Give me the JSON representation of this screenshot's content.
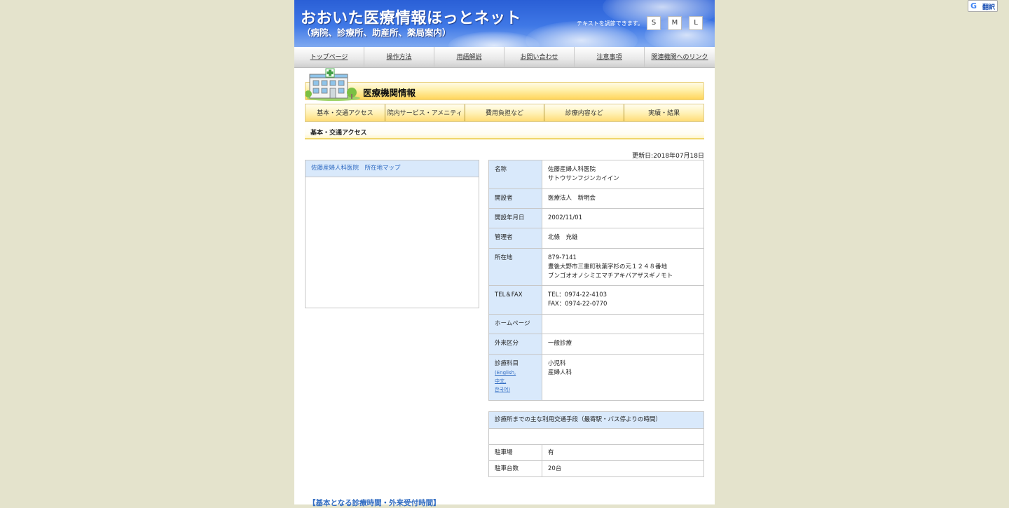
{
  "translate": {
    "g_icon": "G",
    "label": "翻訳"
  },
  "header": {
    "title": "おおいた医療情報ほっとネット",
    "subtitle": "（病院、診療所、助産所、薬局案内）",
    "textsize_label": "テキストを調節できます。",
    "sizes": [
      "S",
      "M",
      "L"
    ]
  },
  "nav": {
    "items": [
      "トップページ",
      "操作方法",
      "用語解説",
      "お問い合わせ",
      "注意事項",
      "関連機関へのリンク"
    ]
  },
  "section": {
    "title": "医療機関情報",
    "icon": "hospital-icon"
  },
  "tabs": [
    "基本・交通アクセス",
    "院内サービス・アメニティ",
    "費用負担など",
    "診療内容など",
    "実績・結果"
  ],
  "subhead": "基本・交通アクセス",
  "updated": "更新日:2018年07月18日",
  "map": {
    "title": "佐藤産婦人科医院　所在地マップ"
  },
  "info": {
    "name_label": "名称",
    "name": "佐藤産婦人科医院",
    "name_kana": "サトウサンフジンカイイン",
    "founder_label": "開設者",
    "founder": "医療法人　新明会",
    "opened_label": "開設年月日",
    "opened": "2002/11/01",
    "manager_label": "管理者",
    "manager": "北條　充雄",
    "address_label": "所在地",
    "zip": "879-7141",
    "address": "豊後大野市三重町秋葉字杉の元１２４８番地",
    "address_kana": "ブンゴオオノシミエマチアキバアザスギノモト",
    "tel_label": "TEL＆FAX",
    "tel": "TEL：0974-22-4103",
    "fax": "FAX：0974-22-0770",
    "homepage_label": "ホームページ",
    "homepage": "",
    "outpatient_label": "外来区分",
    "outpatient": "一般診療",
    "departments_label": "診療科目",
    "lang_links": [
      "(English,",
      "中文,",
      "한국어)"
    ],
    "departments": [
      "小児科",
      "産婦人科"
    ]
  },
  "access": {
    "header": "診療所までの主な利用交通手段（最寄駅・バス停よりの時間）",
    "transport": "",
    "parking_label": "駐車場",
    "parking": "有",
    "parking_count_label": "駐車台数",
    "parking_count": "20台"
  },
  "footer": {
    "hours_link": "【基本となる診療時間・外来受付時間】"
  }
}
